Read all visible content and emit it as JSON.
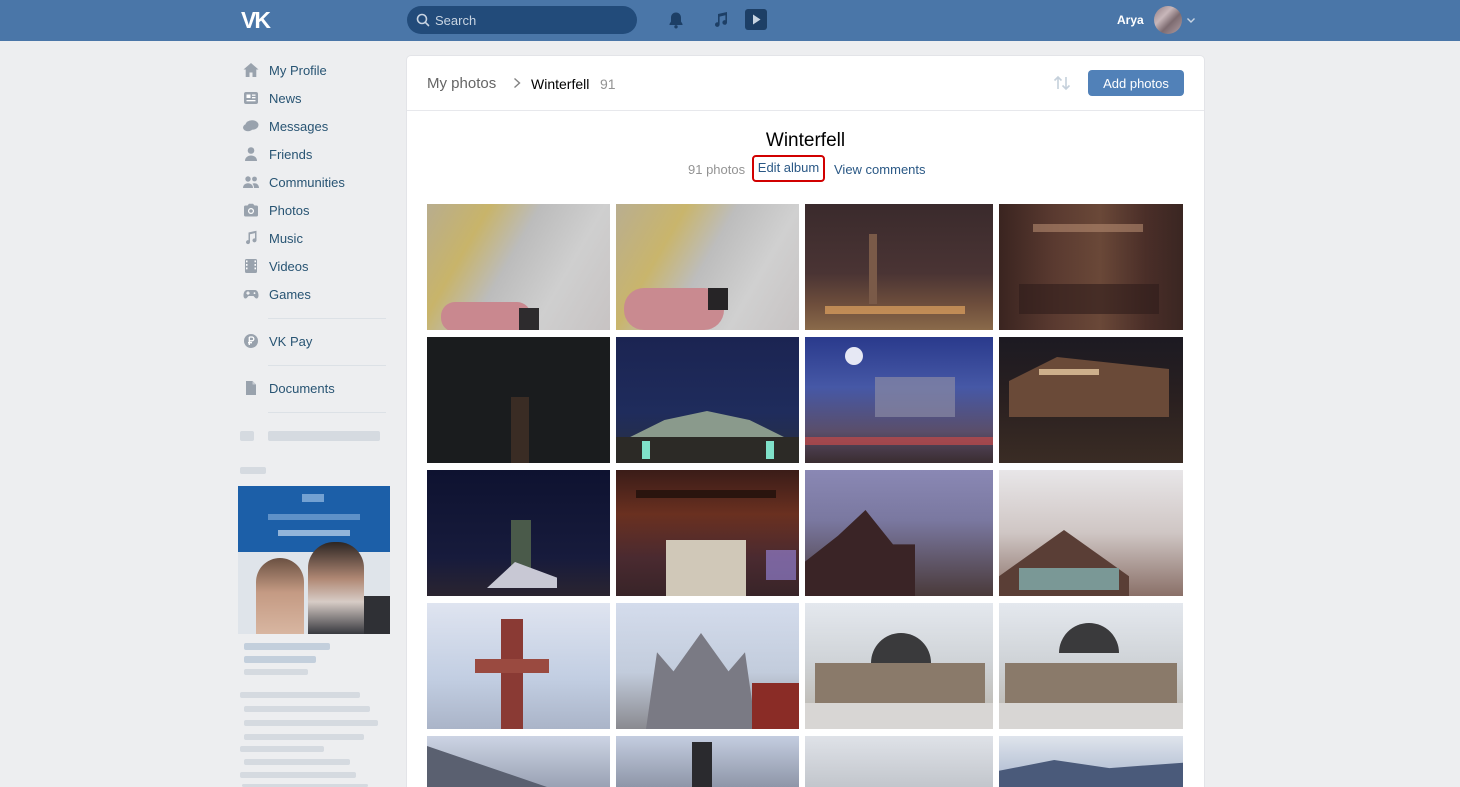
{
  "header": {
    "logo_text": "VK",
    "search_placeholder": "Search",
    "user_name": "Arya"
  },
  "sidebar": {
    "items": [
      {
        "label": "My Profile",
        "icon": "home-icon"
      },
      {
        "label": "News",
        "icon": "news-icon"
      },
      {
        "label": "Messages",
        "icon": "messages-icon"
      },
      {
        "label": "Friends",
        "icon": "friend-icon"
      },
      {
        "label": "Communities",
        "icon": "communities-icon"
      },
      {
        "label": "Photos",
        "icon": "camera-icon"
      },
      {
        "label": "Music",
        "icon": "music-note-icon"
      },
      {
        "label": "Videos",
        "icon": "film-icon"
      },
      {
        "label": "Games",
        "icon": "gamepad-icon"
      },
      {
        "label": "VK Pay",
        "icon": "ruble-coin-icon"
      },
      {
        "label": "Documents",
        "icon": "document-icon"
      }
    ]
  },
  "breadcrumb": {
    "root": "My photos",
    "current": "Winterfell",
    "count": "91"
  },
  "toolbar": {
    "add_photos_label": "Add photos"
  },
  "album": {
    "title": "Winterfell",
    "photo_count": "91 photos",
    "separator": "·",
    "edit_label": "Edit album",
    "comments_label": "View comments"
  },
  "colors": {
    "header_bg": "#4a76a8",
    "accent_button": "#5181b8",
    "link": "#2a5885",
    "highlight_border": "#d10000"
  }
}
